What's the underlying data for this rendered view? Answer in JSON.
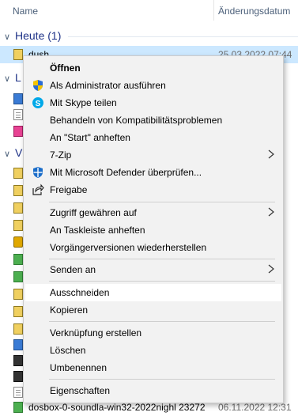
{
  "explorer": {
    "columns": {
      "name": "Name",
      "date": "Änderungsdatum"
    },
    "groups": {
      "today": "Heute (1)",
      "second_visible": "L",
      "third_visible": "V"
    },
    "rows": {
      "selected_name": "dush",
      "selected_date": "25.03.2022 07:44",
      "bottom_name": "dosbox-0-soundla-win32-2022nighl 23272",
      "bottom_date": "06.11.2022 12:31"
    }
  },
  "menu": {
    "items": [
      {
        "label": "Öffnen",
        "icon": "none"
      },
      {
        "label": "Als Administrator ausführen",
        "icon": "shield-icon"
      },
      {
        "label": "Mit Skype teilen",
        "icon": "skype-icon"
      },
      {
        "label": "Behandeln von Kompatibilitätsproblemen",
        "icon": "none"
      },
      {
        "label": "An \"Start\" anheften",
        "icon": "none"
      },
      {
        "label": "7-Zip",
        "icon": "none",
        "submenu": true
      },
      {
        "label": "Mit Microsoft Defender überprüfen...",
        "icon": "defender-icon"
      },
      {
        "label": "Freigabe",
        "icon": "share-icon"
      },
      {
        "label": "Zugriff gewähren auf",
        "icon": "none",
        "submenu": true
      },
      {
        "label": "An Taskleiste anheften",
        "icon": "none"
      },
      {
        "label": "Vorgängerversionen wiederherstellen",
        "icon": "none"
      },
      {
        "label": "Senden an",
        "icon": "none",
        "submenu": true
      },
      {
        "label": "Ausschneiden",
        "icon": "none",
        "highlighted": true
      },
      {
        "label": "Kopieren",
        "icon": "none"
      },
      {
        "label": "Verknüpfung erstellen",
        "icon": "none"
      },
      {
        "label": "Löschen",
        "icon": "none"
      },
      {
        "label": "Umbenennen",
        "icon": "none"
      },
      {
        "label": "Eigenschaften",
        "icon": "none"
      }
    ]
  },
  "colors": {
    "selection": "#cce8ff",
    "menu_bg": "#f2f2f2",
    "menu_hover": "#ffffff",
    "group_text": "#1e3287"
  }
}
